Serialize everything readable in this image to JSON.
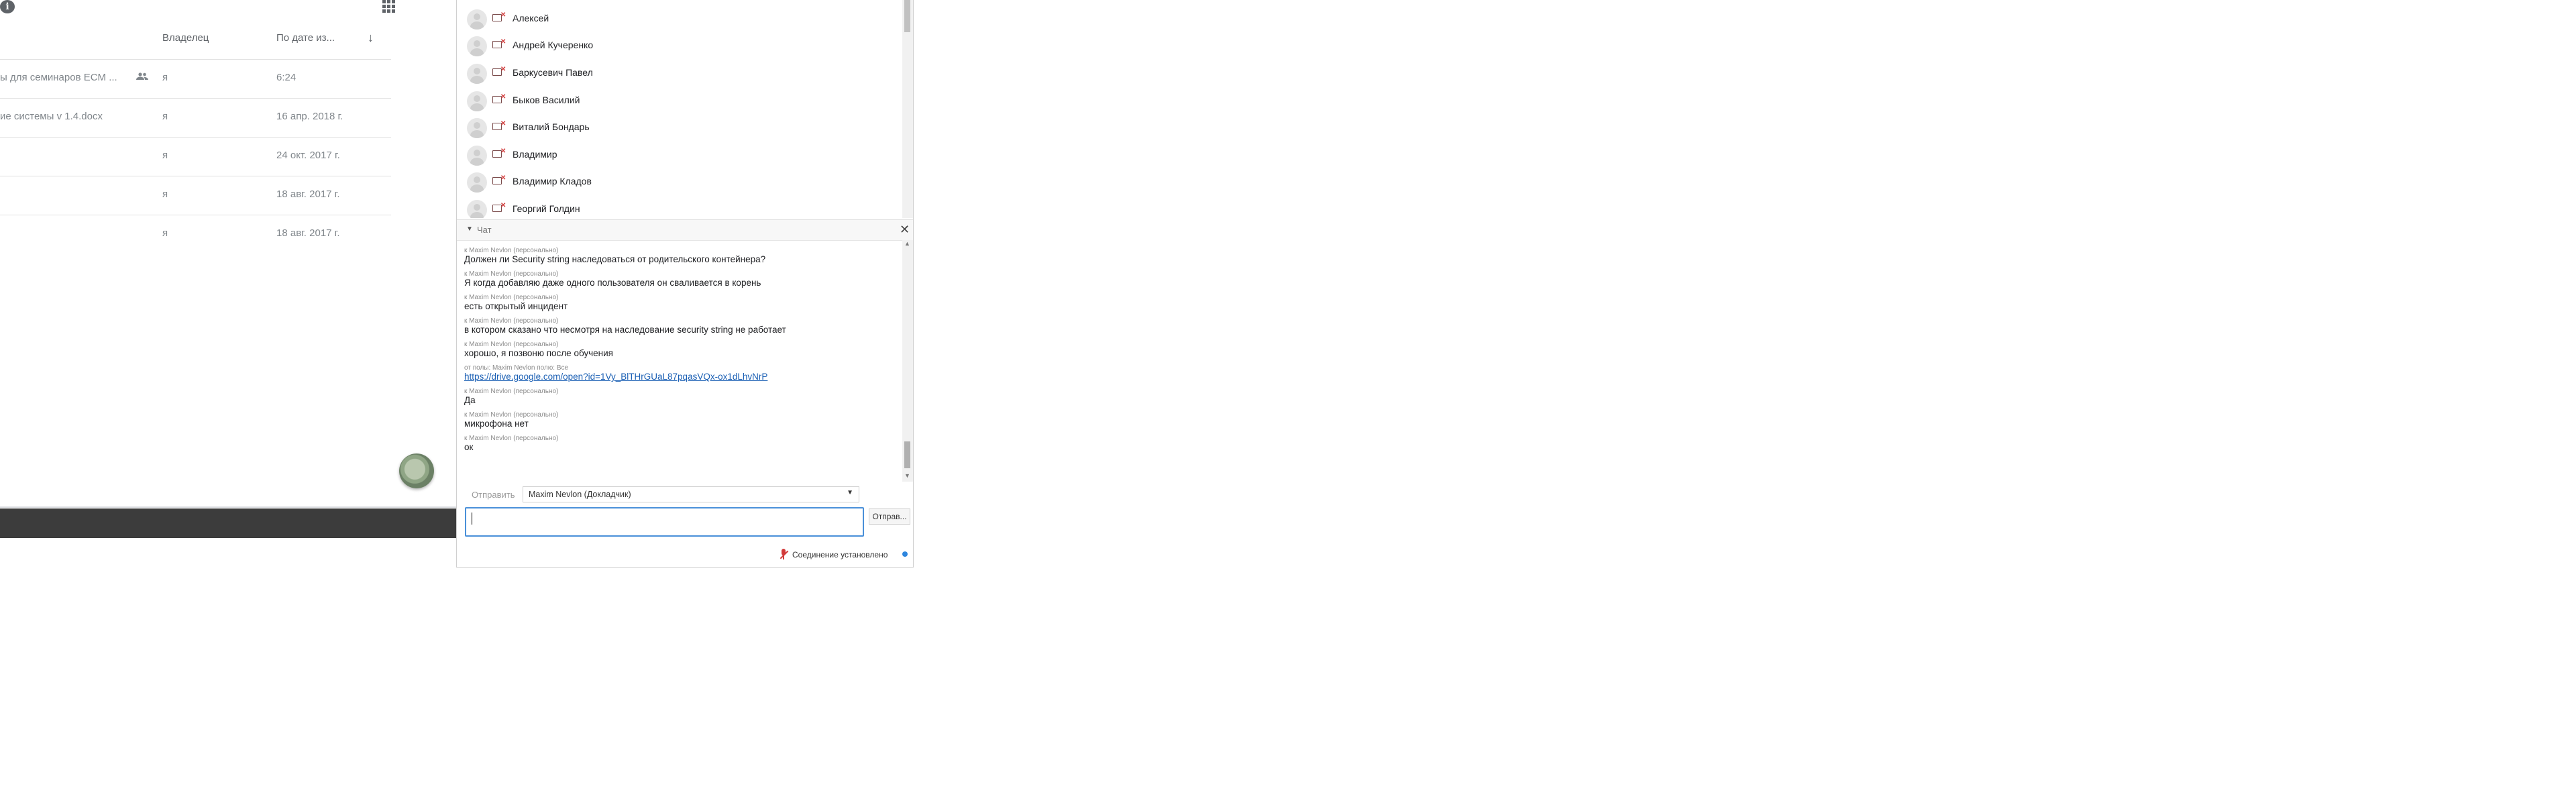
{
  "drive": {
    "header": {
      "owner": "Владелец",
      "date": "По дате из..."
    },
    "rows": [
      {
        "name": "ы для семинаров ECM ...",
        "shared": true,
        "owner": "я",
        "date": "6:24"
      },
      {
        "name": "ие системы v 1.4.docx",
        "shared": false,
        "owner": "я",
        "date": "16 апр. 2018 г."
      },
      {
        "name": "",
        "shared": false,
        "owner": "я",
        "date": "24 окт. 2017 г."
      },
      {
        "name": "",
        "shared": false,
        "owner": "я",
        "date": "18 авг. 2017 г."
      },
      {
        "name": "",
        "shared": false,
        "owner": "я",
        "date": "18 авг. 2017 г."
      }
    ]
  },
  "contacts": [
    {
      "name": "Алексей"
    },
    {
      "name": "Андрей Кучеренко"
    },
    {
      "name": "Баркусевич Павел"
    },
    {
      "name": "Быков Василий"
    },
    {
      "name": "Виталий Бондарь"
    },
    {
      "name": "Владимир"
    },
    {
      "name": "Владимир Кладов"
    },
    {
      "name": "Георгий Голдин"
    }
  ],
  "chat": {
    "title": "Чат",
    "messages": [
      {
        "meta": "к Maxim Nevlon (персонально)",
        "text": "Должен ли Security string наследоваться от родительского контейнера?"
      },
      {
        "meta": "к Maxim Nevlon (персонально)",
        "text": "Я когда добавляю даже одного пользователя он сваливается в корень"
      },
      {
        "meta": "к Maxim Nevlon (персонально)",
        "text": "есть открытый инцидент"
      },
      {
        "meta": "к Maxim Nevlon (персонально)",
        "text": "в котором сказано что несмотря на наследование security string не работает"
      },
      {
        "meta": "к Maxim Nevlon (персонально)",
        "text": "хорошо, я позвоню после обучения"
      },
      {
        "meta": "от полы: Maxim Nevlon полю: Все",
        "link": "https://drive.google.com/open?id=1Vy_BlTHrGUaL87pqasVQx-ox1dLhvNrP"
      },
      {
        "meta": "к Maxim Nevlon (персонально)",
        "text": "Да"
      },
      {
        "meta": "к Maxim Nevlon (персонально)",
        "text": "микрофона нет"
      },
      {
        "meta": "к Maxim Nevlon (персонально)",
        "text": "ок"
      }
    ],
    "send_to_label": "Отправить",
    "recipient": "Maxim Nevlon (Докладчик)",
    "send_button": "Отправ...",
    "connection": "Соединение установлено"
  }
}
